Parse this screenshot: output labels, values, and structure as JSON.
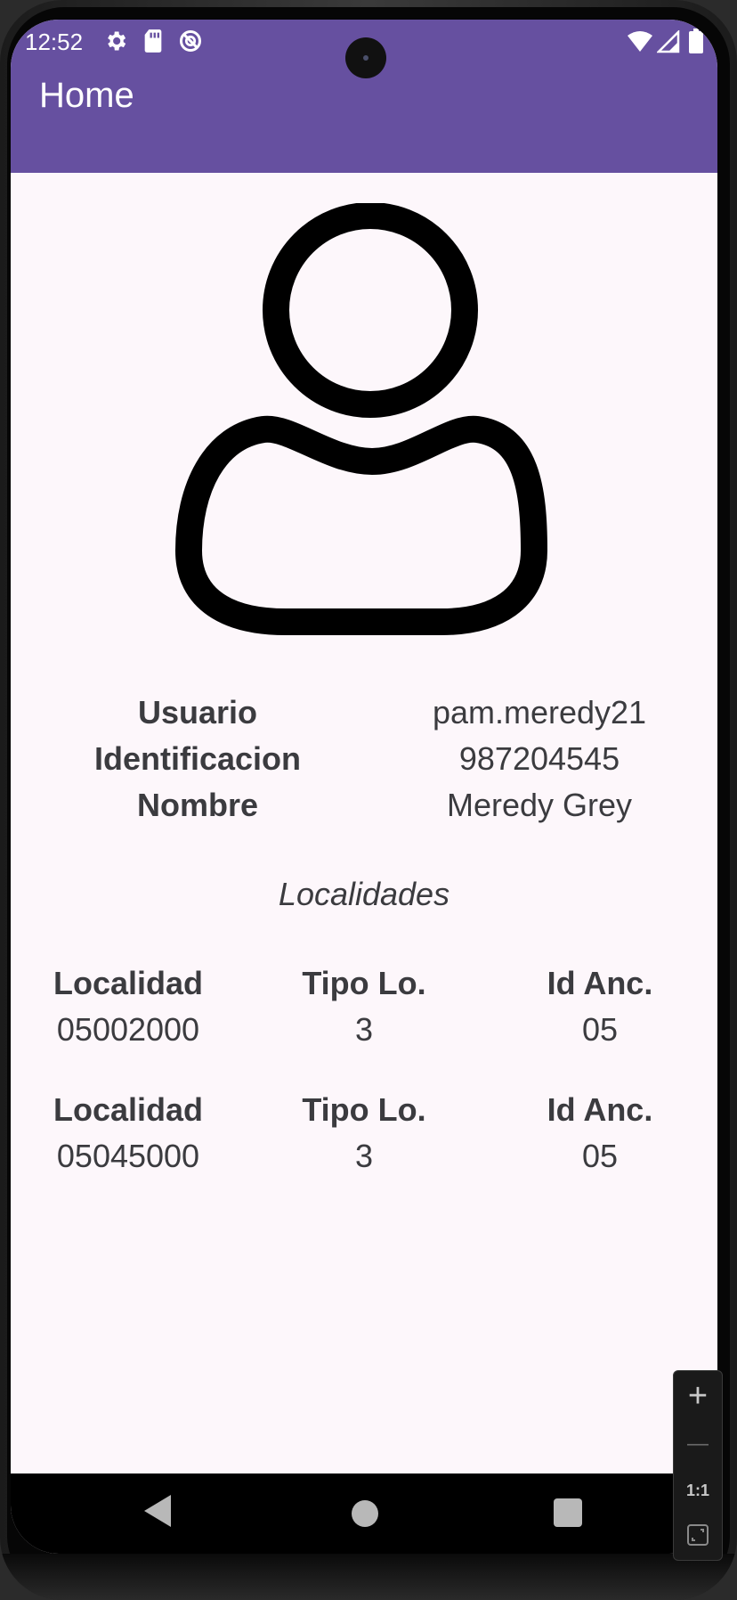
{
  "status_bar": {
    "time": "12:52",
    "icons_left": [
      "gear-icon",
      "sd-card-icon",
      "no-tracking-icon"
    ],
    "icons_right": [
      "wifi-icon",
      "signal-icon",
      "battery-icon"
    ]
  },
  "app_bar": {
    "title": "Home",
    "color": "#6650a0"
  },
  "profile": {
    "avatar_icon": "person-outline-icon",
    "rows": [
      {
        "label": "Usuario",
        "value": "pam.meredy21"
      },
      {
        "label": "Identificacion",
        "value": "987204545"
      },
      {
        "label": "Nombre",
        "value": "Meredy Grey"
      }
    ]
  },
  "localidades": {
    "title": "Localidades",
    "headers": {
      "localidad": "Localidad",
      "tipo": "Tipo Lo.",
      "id_anc": "Id Anc."
    },
    "items": [
      {
        "localidad": "05002000",
        "tipo": "3",
        "id_anc": "05"
      },
      {
        "localidad": "05045000",
        "tipo": "3",
        "id_anc": "05"
      }
    ]
  },
  "nav_bar": {
    "buttons": [
      "back-icon",
      "home-icon",
      "recents-icon"
    ]
  },
  "zoom_controls": {
    "plus": "+",
    "minus": "—",
    "one_to_one": "1:1",
    "fit_icon": "fit-screen-icon"
  }
}
